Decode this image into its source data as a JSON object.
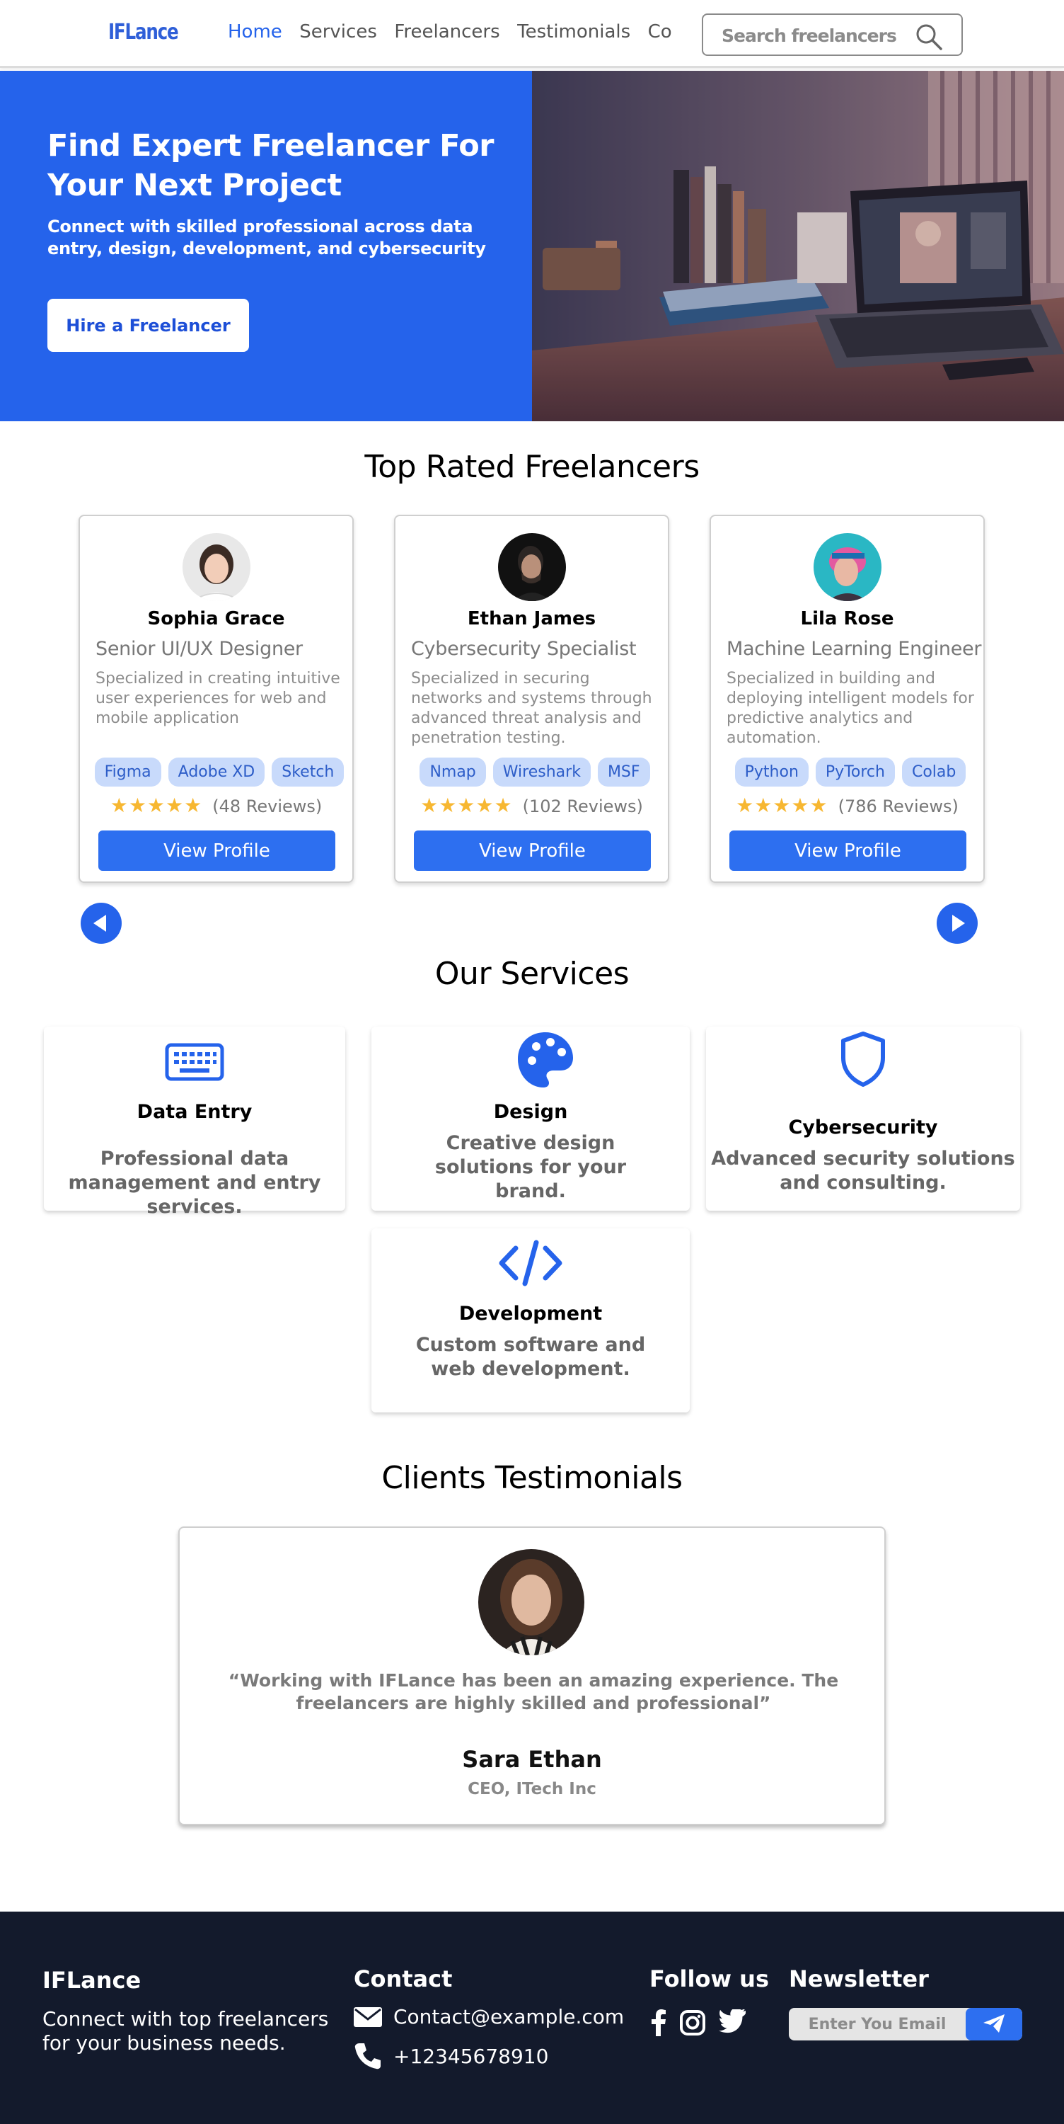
{
  "nav": {
    "logo": "IFLance",
    "links": [
      "Home",
      "Services",
      "Freelancers",
      "Testimonials",
      "Contact"
    ],
    "search_placeholder": "Search freelancers"
  },
  "hero": {
    "title": "Find Expert Freelancer For Your Next Project",
    "subtitle": "Connect with skilled professional across data entry, design, development, and cybersecurity",
    "cta": "Hire a Freelancer"
  },
  "freelancers": {
    "title": "Top Rated Freelancers",
    "cards": [
      {
        "name": "Sophia Grace",
        "role": "Senior UI/UX Designer",
        "desc": "Specialized in creating intuitive user experiences for web and mobile application",
        "tags": [
          "Figma",
          "Adobe XD",
          "Sketch"
        ],
        "stars": "★★★★★",
        "reviews": "(48 Reviews)",
        "button": "View Profile"
      },
      {
        "name": "Ethan James",
        "role": "Cybersecurity Specialist",
        "desc": "Specialized in securing networks and systems through advanced threat analysis and penetration testing.",
        "tags": [
          "Nmap",
          "Wireshark",
          "MSF"
        ],
        "stars": "★★★★★",
        "reviews": "(102 Reviews)",
        "button": "View Profile"
      },
      {
        "name": "Lila Rose",
        "role": "Machine Learning Engineer",
        "desc": "Specialized in building and deploying intelligent models for predictive analytics and automation.",
        "tags": [
          "Python",
          "PyTorch",
          "Colab"
        ],
        "stars": "★★★★★",
        "reviews": "(786 Reviews)",
        "button": "View Profile"
      }
    ]
  },
  "services": {
    "title": "Our Services",
    "items": [
      {
        "title": "Data Entry",
        "desc": "Professional data management and entry services.",
        "icon": "keyboard-icon"
      },
      {
        "title": "Design",
        "desc": "Creative design solutions for your brand.",
        "icon": "palette-icon"
      },
      {
        "title": "Cybersecurity",
        "desc": "Advanced security solutions and consulting.",
        "icon": "shield-icon"
      },
      {
        "title": "Development",
        "desc": "Custom software and web development.",
        "icon": "code-icon"
      }
    ]
  },
  "testimonials": {
    "title": "Clients Testimonials",
    "quote": "“Working with IFLance has been an amazing experience. The freelancers are highly skilled and professional”",
    "name": "Sara Ethan",
    "role": "CEO, ITech Inc"
  },
  "footer": {
    "brand": "IFLance",
    "tagline": "Connect with top freelancers for your business needs.",
    "contact_title": "Contact",
    "email": "Contact@example.com",
    "phone": "+12345678910",
    "follow_title": "Follow us",
    "newsletter_title": "Newsletter",
    "newsletter_placeholder": "Enter You Email"
  },
  "colors": {
    "brand": "#2563eb",
    "footer": "#131a2c",
    "tag_bg": "#c8dafb",
    "star": "#f7b731"
  }
}
